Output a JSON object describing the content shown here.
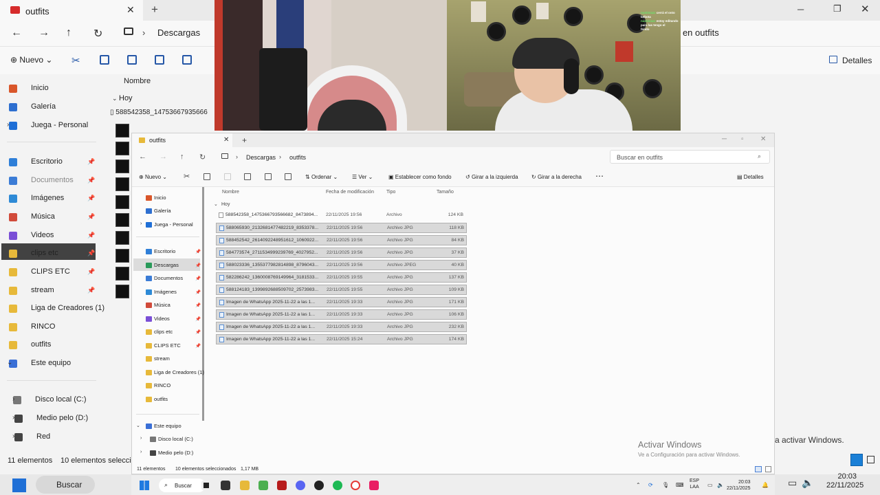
{
  "bg_explorer": {
    "tab_title": "outfits",
    "breadcrumb": "Descargas",
    "search_label": "r en outfits",
    "new_label": "Nuevo",
    "details_label": "Detalles",
    "column_name": "Nombre",
    "group_today": "Hoy",
    "first_file": "588542358_14753667935666",
    "sidebar": [
      {
        "label": "Inicio",
        "color": "#d9562a"
      },
      {
        "label": "Galería",
        "color": "#2e6fd0"
      },
      {
        "label": "Juega - Personal",
        "color": "#1f6fd6"
      },
      {
        "label": "Escritorio",
        "color": "#2f7fd8"
      },
      {
        "label": "Documentos",
        "color": "#3b7cd6"
      },
      {
        "label": "Imágenes",
        "color": "#2e8ad6"
      },
      {
        "label": "Música",
        "color": "#d14a3a"
      },
      {
        "label": "Videos",
        "color": "#7a4fd6"
      },
      {
        "label": "clips etc",
        "color": "#e7b93a"
      },
      {
        "label": "CLIPS ETC",
        "color": "#e7b93a"
      },
      {
        "label": "stream",
        "color": "#e7b93a"
      },
      {
        "label": "Liga de Creadores (1)",
        "color": "#e7b93a"
      },
      {
        "label": "RINCO",
        "color": "#e7b93a"
      },
      {
        "label": "outfits",
        "color": "#e7b93a"
      },
      {
        "label": "Este equipo",
        "color": "#3a6fd6"
      },
      {
        "label": "Disco local (C:)",
        "color": "#777777"
      },
      {
        "label": "Medio pelo (D:)",
        "color": "#444444"
      },
      {
        "label": "Red",
        "color": "#444444"
      }
    ],
    "status_items": "11 elementos",
    "status_selected": "10 elementos seleccion",
    "activate_text": "a activar Windows.",
    "clock_time": "20:03",
    "clock_date": "22/11/2025"
  },
  "window": {
    "tab_title": "outfits",
    "breadcrumb": [
      "Descargas",
      "outfits"
    ],
    "search_placeholder": "Buscar en outfits",
    "commands": {
      "new": "Nuevo",
      "sort": "Ordenar",
      "view": "Ver",
      "set_background": "Establecer como fondo",
      "rotate_left": "Girar a la izquierda",
      "rotate_right": "Girar a la derecha",
      "details": "Detalles"
    },
    "sidebar": [
      {
        "label": "Inicio",
        "color": "#d9562a",
        "pinned": false
      },
      {
        "label": "Galería",
        "color": "#2e6fd0",
        "pinned": false
      },
      {
        "label": "Juega - Personal",
        "color": "#1f6fd6",
        "pinned": false
      },
      {
        "label": "Escritorio",
        "color": "#2f7fd8",
        "pinned": true
      },
      {
        "label": "Descargas",
        "color": "#2a9a5a",
        "pinned": true
      },
      {
        "label": "Documentos",
        "color": "#3b7cd6",
        "pinned": true
      },
      {
        "label": "Imágenes",
        "color": "#2e8ad6",
        "pinned": true
      },
      {
        "label": "Música",
        "color": "#d14a3a",
        "pinned": true
      },
      {
        "label": "Videos",
        "color": "#7a4fd6",
        "pinned": true
      },
      {
        "label": "clips etc",
        "color": "#e7b93a",
        "pinned": true
      },
      {
        "label": "CLIPS ETC",
        "color": "#e7b93a",
        "pinned": true
      },
      {
        "label": "stream",
        "color": "#e7b93a",
        "pinned": false
      },
      {
        "label": "Liga de Creadores (1)",
        "color": "#e7b93a",
        "pinned": false
      },
      {
        "label": "RINCO",
        "color": "#e7b93a",
        "pinned": false
      },
      {
        "label": "outfits",
        "color": "#e7b93a",
        "pinned": false
      },
      {
        "label": "Este equipo",
        "color": "#3a6fd6",
        "pinned": false
      },
      {
        "label": "Disco local (C:)",
        "color": "#777777",
        "pinned": false
      },
      {
        "label": "Medio pelo (D:)",
        "color": "#444444",
        "pinned": false
      },
      {
        "label": "Red",
        "color": "#444444",
        "pinned": false
      }
    ],
    "columns": [
      "Nombre",
      "Fecha de modificación",
      "Tipo",
      "Tamaño"
    ],
    "group": "Hoy",
    "files": [
      {
        "name": "588542358_1475366793566682_8473894...",
        "date": "22/11/2025 19:56",
        "type": "Archivo",
        "size": "124 KB",
        "selected": false
      },
      {
        "name": "588065930_2132681477482219_8353378...",
        "date": "22/11/2025 19:56",
        "type": "Archivo JPG",
        "size": "118 KB",
        "selected": true
      },
      {
        "name": "588452542_2614092248951612_1060922...",
        "date": "22/11/2025 19:56",
        "type": "Archivo JPG",
        "size": "84 KB",
        "selected": true
      },
      {
        "name": "584773574_2711534999239769_4027952...",
        "date": "22/11/2025 19:56",
        "type": "Archivo JPG",
        "size": "37 KB",
        "selected": true
      },
      {
        "name": "588023336_1355377982814898_8796043...",
        "date": "22/11/2025 19:56",
        "type": "Archivo JPEG",
        "size": "40 KB",
        "selected": true
      },
      {
        "name": "582286242_1360008769149964_3181533...",
        "date": "22/11/2025 19:55",
        "type": "Archivo JPG",
        "size": "137 KB",
        "selected": true
      },
      {
        "name": "588124183_1399892688509702_2573983...",
        "date": "22/11/2025 19:55",
        "type": "Archivo JPG",
        "size": "109 KB",
        "selected": true
      },
      {
        "name": "Imagen de WhatsApp 2025-11-22 a las 1...",
        "date": "22/11/2025 19:33",
        "type": "Archivo JPG",
        "size": "171 KB",
        "selected": true
      },
      {
        "name": "Imagen de WhatsApp 2025-11-22 a las 1...",
        "date": "22/11/2025 19:33",
        "type": "Archivo JPG",
        "size": "106 KB",
        "selected": true
      },
      {
        "name": "Imagen de WhatsApp 2025-11-22 a las 1...",
        "date": "22/11/2025 19:33",
        "type": "Archivo JPG",
        "size": "232 KB",
        "selected": true
      },
      {
        "name": "Imagen de WhatsApp 2025-11-22 a las 1...",
        "date": "22/11/2025 15:24",
        "type": "Archivo JPG",
        "size": "174 KB",
        "selected": true
      }
    ],
    "status": {
      "items": "11 elementos",
      "selected": "10 elementos seleccionados",
      "size": "1,17 MB"
    },
    "activate_title": "Activar Windows",
    "activate_sub": "Ve a Configuración para activar Windows."
  },
  "taskbar": {
    "search_label": "Buscar",
    "lang1": "ESP",
    "lang2": "LAA",
    "time": "20:03",
    "date": "22/11/2025"
  },
  "bg_taskbar": {
    "search_label": "Buscar"
  },
  "chat_overlay": [
    {
      "user": "nustiviazz",
      "text": "cerrá el onto"
    },
    {
      "user": "",
      "text": "bebota"
    },
    {
      "user": "nustiviazz",
      "text": "estoy editando"
    },
    {
      "user": "",
      "text": "para las tengo el"
    },
    {
      "user": "",
      "text": "fondo"
    }
  ]
}
